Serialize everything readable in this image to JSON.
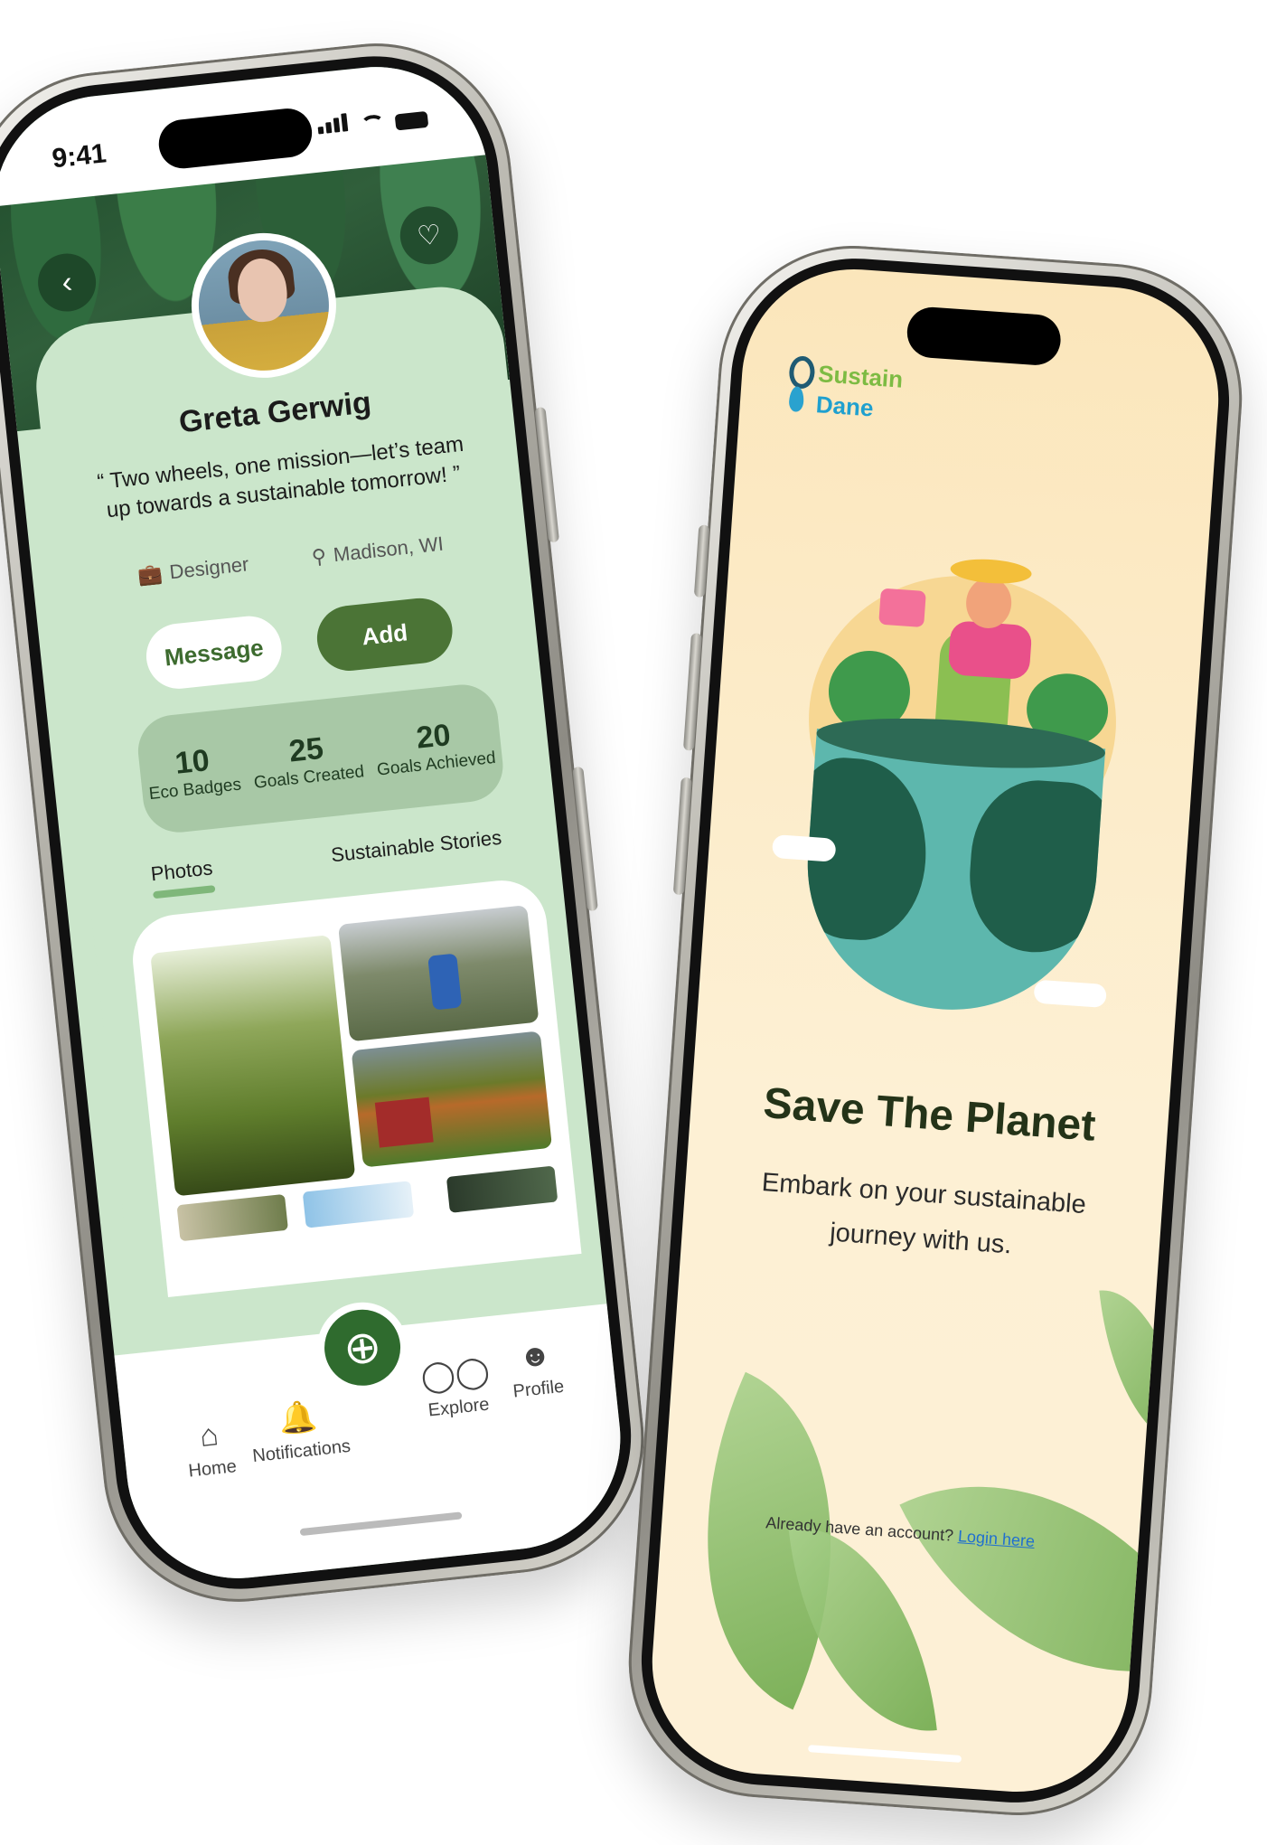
{
  "left_phone": {
    "status_time": "9:41",
    "profile": {
      "name": "Greta Gerwig",
      "quote": "“ Two wheels, one mission—let’s team up towards a sustainable tomorrow! ”",
      "role": "Designer",
      "location": "Madison, WI"
    },
    "buttons": {
      "message": "Message",
      "add": "Add"
    },
    "stats": [
      {
        "value": "10",
        "label": "Eco Badges"
      },
      {
        "value": "25",
        "label": "Goals Created"
      },
      {
        "value": "20",
        "label": "Goals Achieved"
      }
    ],
    "tabs": {
      "photos": "Photos",
      "stories": "Sustainable Stories"
    },
    "nav": {
      "home": "Home",
      "notifications": "Notifications",
      "explore": "Explore",
      "profile": "Profile"
    },
    "icons": {
      "back": "chevron-left",
      "favorite": "heart",
      "role": "briefcase",
      "location": "map-pin",
      "fab": "plus-circle"
    }
  },
  "right_phone": {
    "logo": {
      "line1": "Sustain",
      "line2": "Dane"
    },
    "title": "Save The Planet",
    "subtitle": "Embark on your sustainable journey with us.",
    "login_prompt": "Already have an account?",
    "login_link": "Login here"
  },
  "colors": {
    "accent_green": "#4b7436",
    "card_green": "#cbe6cb",
    "cream": "#fdf0d4",
    "link_blue": "#1f6fd0"
  }
}
